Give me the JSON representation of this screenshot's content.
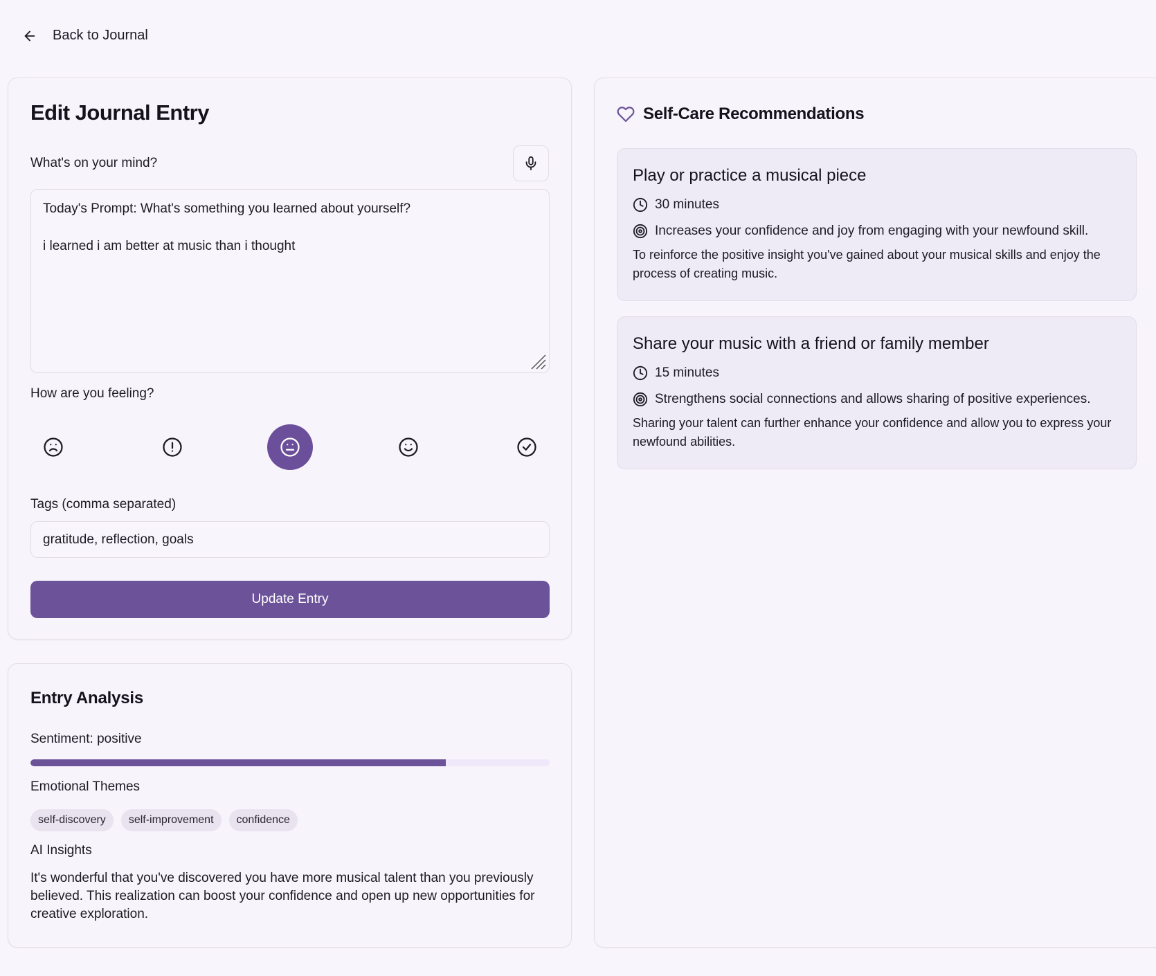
{
  "nav": {
    "back_label": "Back to Journal"
  },
  "editor": {
    "title": "Edit Journal Entry",
    "prompt_label": "What's on your mind?",
    "entry_lines": [
      "Today's Prompt: What's something you learned about yourself?",
      "",
      "i learned i am better at music than i thought"
    ],
    "feeling_label": "How are you feeling?",
    "moods": [
      {
        "icon": "frown-face-icon",
        "selected": false
      },
      {
        "icon": "alert-circle-icon",
        "selected": false
      },
      {
        "icon": "neutral-face-icon",
        "selected": true
      },
      {
        "icon": "smile-face-icon",
        "selected": false
      },
      {
        "icon": "check-circle-icon",
        "selected": false
      }
    ],
    "tags_label": "Tags (comma separated)",
    "tags_value": "gratitude, reflection, goals",
    "submit_label": "Update Entry"
  },
  "analysis": {
    "title": "Entry Analysis",
    "sentiment_label": "Sentiment: positive",
    "sentiment_score": 0.8,
    "themes_label": "Emotional Themes",
    "themes": [
      "self-discovery",
      "self-improvement",
      "confidence"
    ],
    "insights_label": "AI Insights",
    "insights_text": "It's wonderful that you've discovered you have more musical talent than you previously believed. This realization can boost your confidence and open up new opportunities for creative exploration."
  },
  "selfcare": {
    "title": "Self-Care Recommendations",
    "recommendations": [
      {
        "title": "Play or practice a musical piece",
        "duration": "30 minutes",
        "benefit": "Increases your confidence and joy from engaging with your newfound skill.",
        "description": "To reinforce the positive insight you've gained about your musical skills and enjoy the process of creating music."
      },
      {
        "title": "Share your music with a friend or family member",
        "duration": "15 minutes",
        "benefit": "Strengthens social connections and allows sharing of positive experiences.",
        "description": "Sharing your talent can further enhance your confidence and allow you to express your newfound abilities."
      }
    ]
  },
  "colors": {
    "accent": "#6b5299",
    "background": "#f8f5fc",
    "card_background": "#f7f4fb",
    "recommendation_background": "#efebf6",
    "chip_background": "#e8e3ef"
  }
}
